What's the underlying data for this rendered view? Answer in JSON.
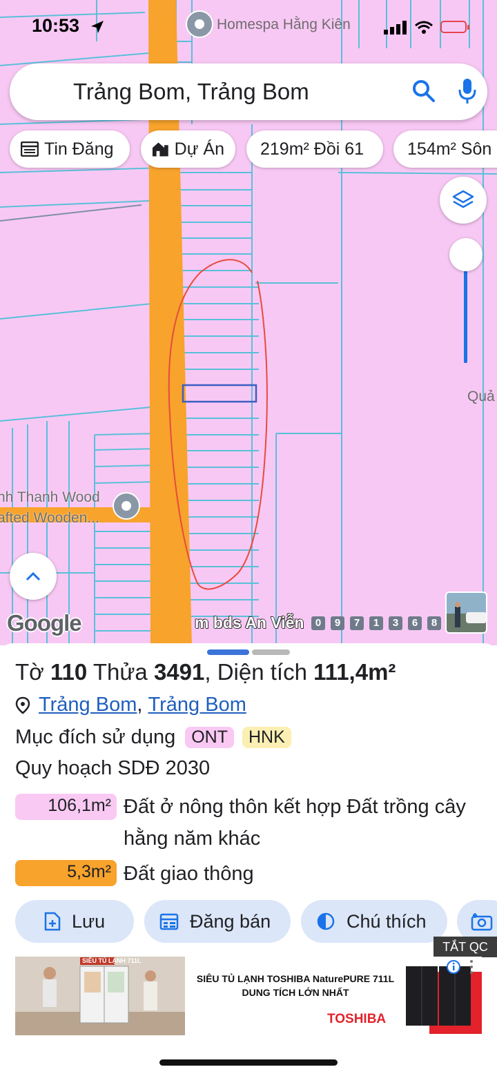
{
  "status_bar": {
    "time": "10:53"
  },
  "map": {
    "poi_top_label": "Homespa Hằng Kiên",
    "poi_left_label_1": "nh Thanh Wood",
    "poi_left_label_2": "afted Wooden...",
    "right_edge_label": "Quả",
    "google_logo": "Google",
    "watermark_text": "m bds An Viễn",
    "watermark_digits": [
      "0",
      "9",
      "7",
      "1",
      "3",
      "6",
      "8"
    ],
    "colors": {
      "land": "#f8c8f4",
      "road": "#f7a32c",
      "parcel_lines": "#58c0d9",
      "highlight": "#3b5fc0",
      "annotation": "#e84b3c"
    }
  },
  "search": {
    "query": "Trảng Bom, Trảng Bom",
    "icons": [
      "search-icon",
      "mic-icon"
    ]
  },
  "chips": [
    {
      "label": "Tin Đăng",
      "icon": "listing-icon"
    },
    {
      "label": "Dự Án",
      "icon": "building-icon"
    },
    {
      "label": "219m² Đồi 61"
    },
    {
      "label": "154m² Sôn"
    }
  ],
  "sheet": {
    "title": {
      "to_label": "Tờ",
      "to_value": "110",
      "thua_label": "Thửa",
      "thua_value": "3491",
      "area_label": "Diện tích",
      "area_value": "111,4m²"
    },
    "location": {
      "part1": "Trảng Bom",
      "sep": ",",
      "part2": "Trảng Bom"
    },
    "purpose": {
      "label": "Mục đích sử dụng",
      "codes": [
        "ONT",
        "HNK"
      ]
    },
    "plan_title": "Quy hoạch SDĐ 2030",
    "plan_rows": [
      {
        "area": "106,1m²",
        "desc": "Đất ở nông thôn kết hợp Đất trồng cây hằng năm khác",
        "color": "#f9c9f4"
      },
      {
        "area": "5,3m²",
        "desc": "Đất giao thông",
        "color": "#f7a32c"
      }
    ],
    "actions": [
      {
        "label": "Lưu",
        "icon": "save-icon"
      },
      {
        "label": "Đăng bán",
        "icon": "calendar-icon"
      },
      {
        "label": "Chú thích",
        "icon": "contrast-icon"
      }
    ]
  },
  "ad": {
    "tag": "TẮT QC",
    "headline_1": "SIÊU TỦ LẠNH TOSHIBA NaturePURE 711L",
    "headline_2": "DUNG TÍCH LỚN NHẤT",
    "brand": "TOSHIBA",
    "image_caption": "SIÊU TỦ LẠNH 711L"
  }
}
